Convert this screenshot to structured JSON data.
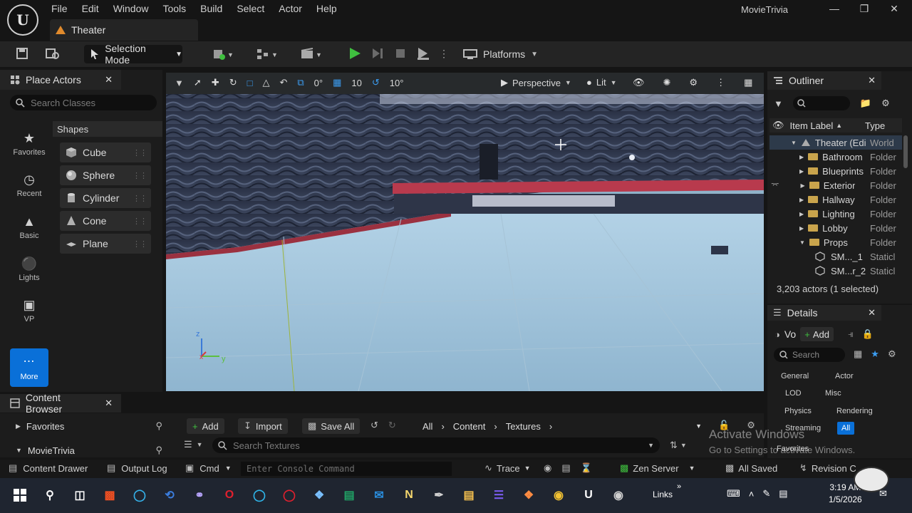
{
  "menu": [
    "File",
    "Edit",
    "Window",
    "Tools",
    "Build",
    "Select",
    "Actor",
    "Help"
  ],
  "doc_tab": "Theater",
  "app_title": "MovieTrivia",
  "toolbar": {
    "selection_mode": "Selection Mode",
    "platforms": "Platforms"
  },
  "place_actors": {
    "title": "Place Actors",
    "search_placeholder": "Search Classes",
    "categories": [
      "Favorites",
      "Recent",
      "Basic",
      "Lights",
      "VP",
      "More"
    ],
    "shapes_header": "Shapes",
    "shapes": [
      "Cube",
      "Sphere",
      "Cylinder",
      "Cone",
      "Plane"
    ]
  },
  "viewport": {
    "snap_translate": "0°",
    "grid": "10",
    "rotate": "10°",
    "perspective": "Perspective",
    "lit": "Lit"
  },
  "outliner": {
    "title": "Outliner",
    "col_label": "Item Label",
    "col_type": "Type",
    "rows": [
      {
        "name": "Theater (Edi",
        "type": "World"
      },
      {
        "name": "Bathroom",
        "type": "Folder"
      },
      {
        "name": "Blueprints",
        "type": "Folder"
      },
      {
        "name": "Exterior",
        "type": "Folder"
      },
      {
        "name": "Hallway",
        "type": "Folder"
      },
      {
        "name": "Lighting",
        "type": "Folder"
      },
      {
        "name": "Lobby",
        "type": "Folder"
      },
      {
        "name": "Props",
        "type": "Folder"
      },
      {
        "name": "SM..._1",
        "type": "Staticl"
      },
      {
        "name": "SM...r_2",
        "type": "Staticl"
      }
    ],
    "actor_count": "3,203 actors (1 selected)"
  },
  "details": {
    "title": "Details",
    "object": "Vo",
    "add": "Add",
    "search_placeholder": "Search",
    "tabs": [
      "General",
      "Actor",
      "LOD",
      "Misc",
      "Physics",
      "Rendering",
      "Streaming",
      "All"
    ],
    "section": "Favorites"
  },
  "content_browser": {
    "title": "Content Browser",
    "add": "Add",
    "import": "Import",
    "save_all": "Save All",
    "path": [
      "All",
      "Content",
      "Textures"
    ],
    "favorites": "Favorites",
    "project": "MovieTrivia",
    "search_placeholder": "Search Textures"
  },
  "statusbar": {
    "content_drawer": "Content Drawer",
    "output_log": "Output Log",
    "cmd": "Cmd",
    "console_placeholder": "Enter Console Command",
    "trace": "Trace",
    "zen_server": "Zen Server",
    "all_saved": "All Saved",
    "revision": "Revision C"
  },
  "watermark": {
    "line1": "Activate Windows",
    "line2": "Go to Settings to activate Windows."
  },
  "taskbar": {
    "links": "Links",
    "time": "3:19 AM",
    "date": "1/5/2026"
  }
}
